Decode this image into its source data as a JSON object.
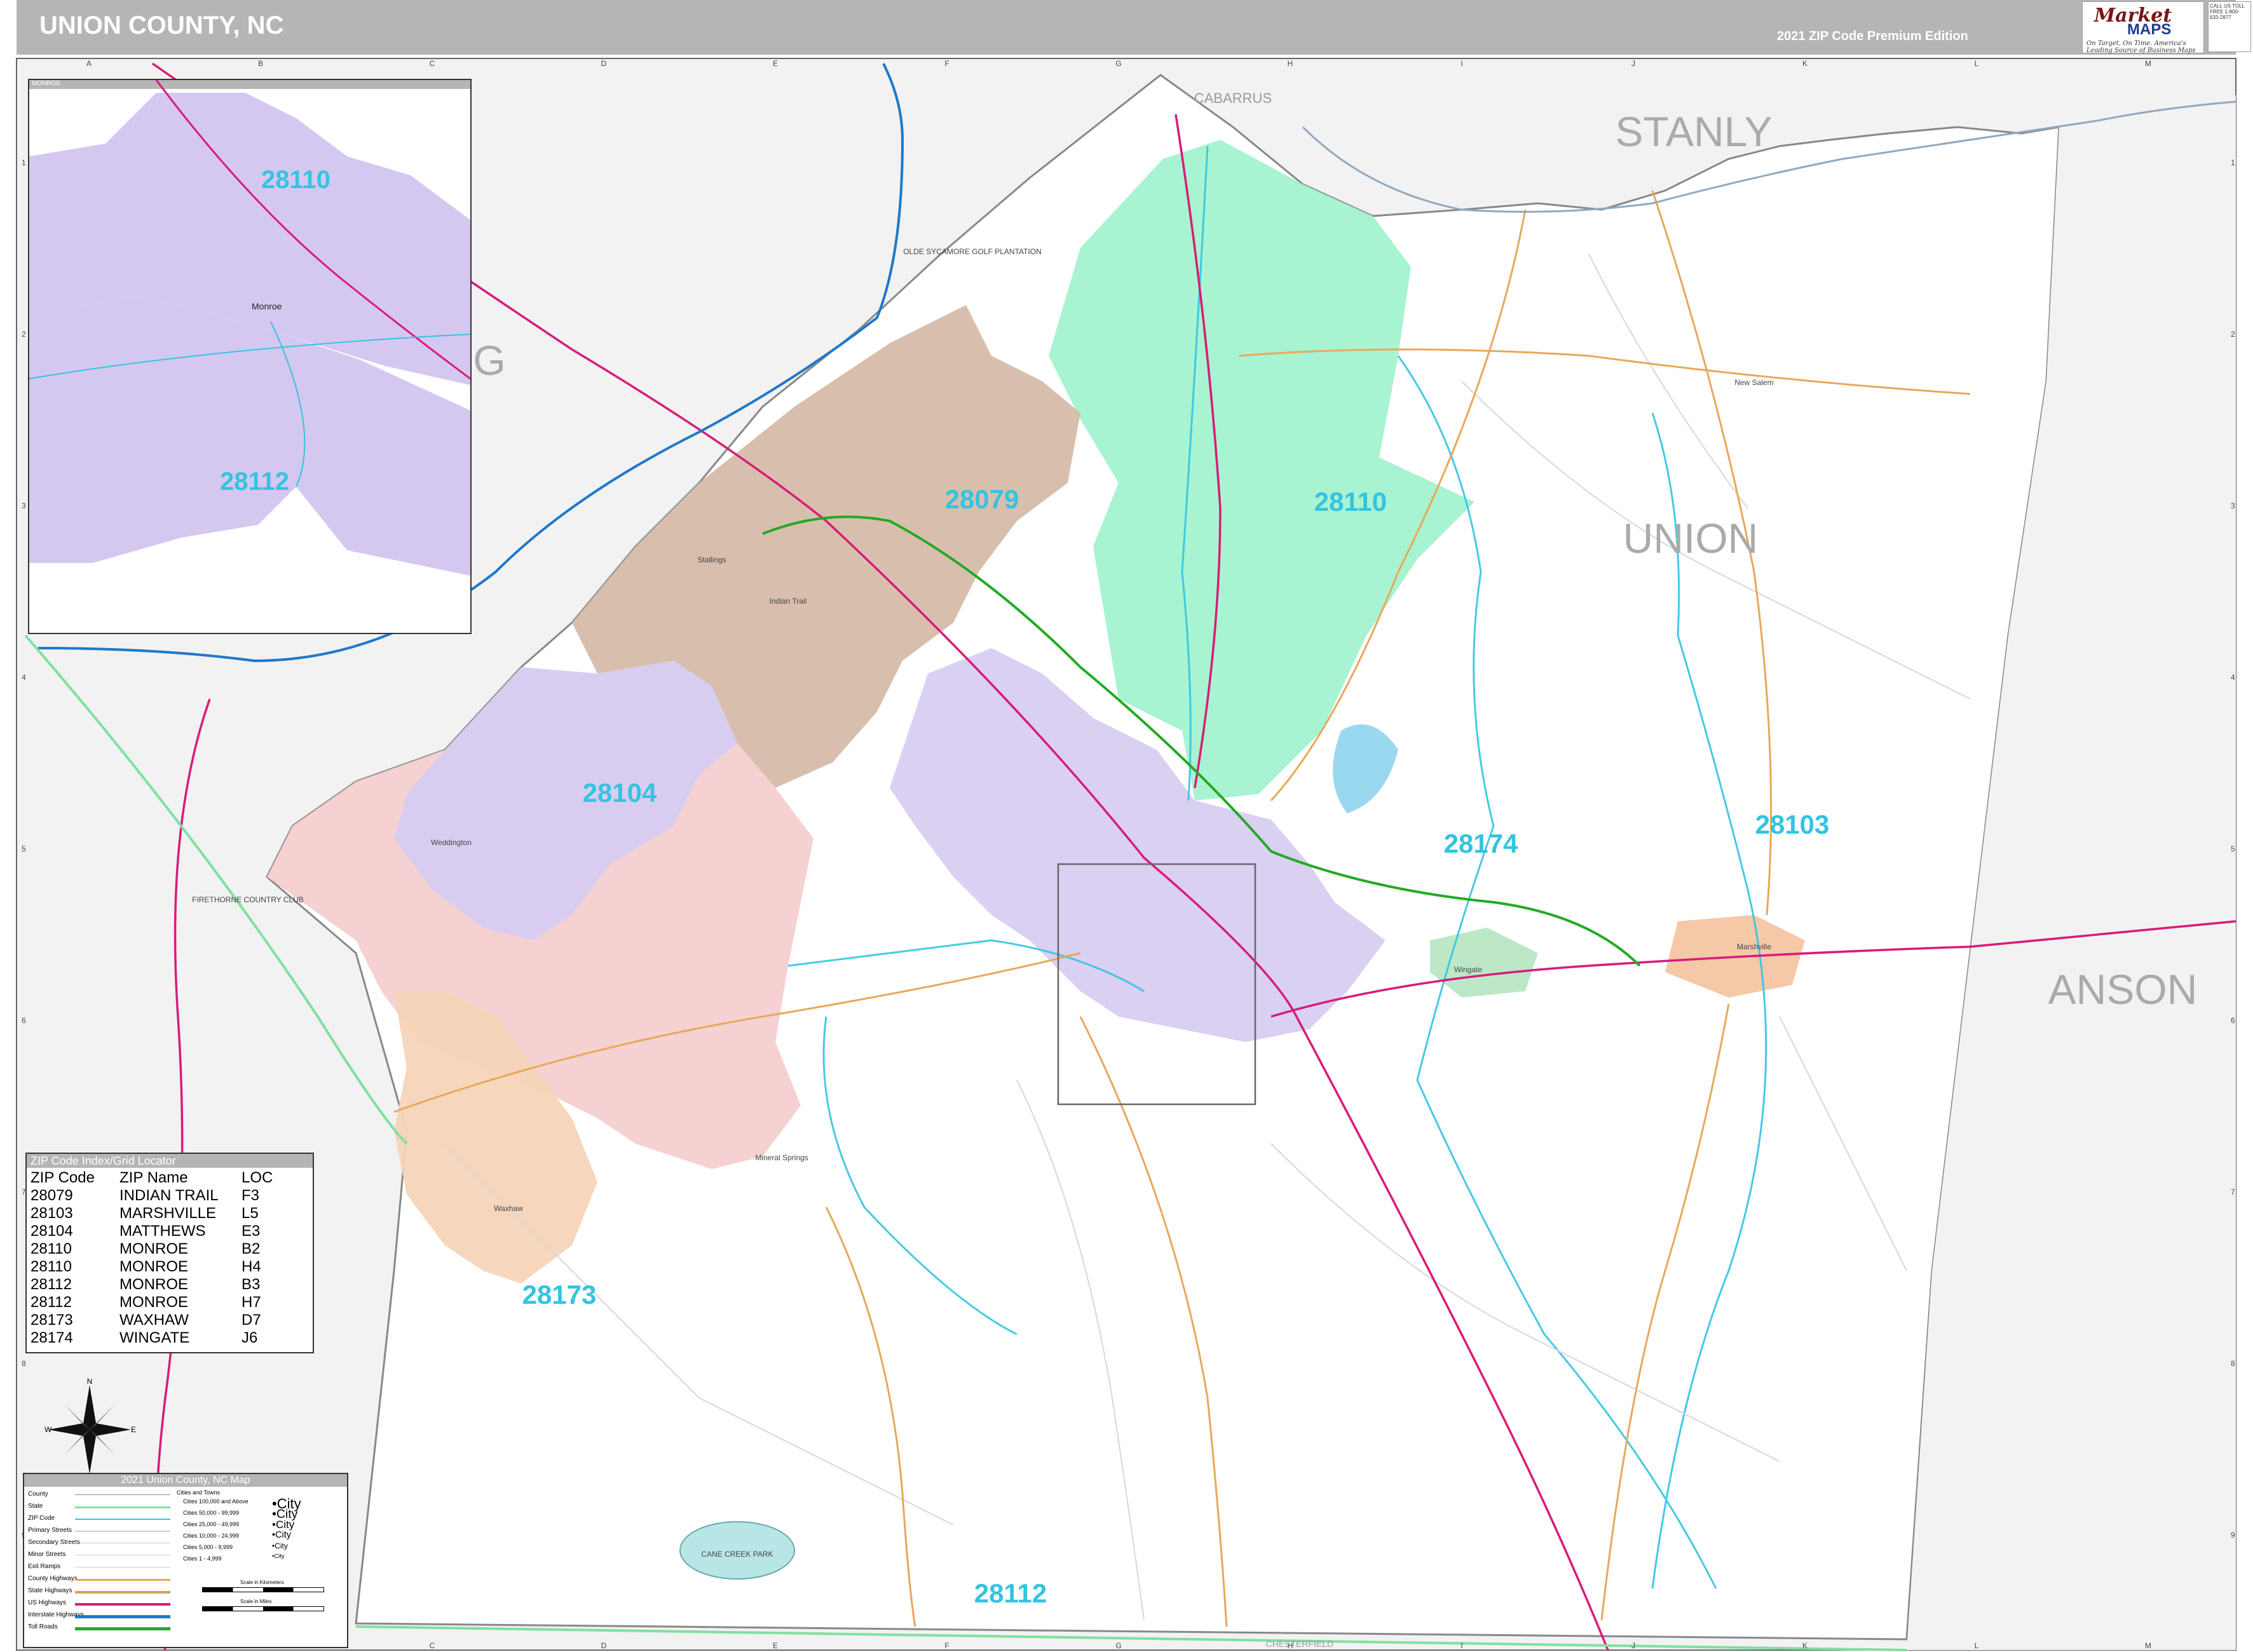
{
  "header": {
    "title": "UNION COUNTY, NC",
    "edition": "2021 ZIP Code Premium Edition",
    "logo_brand": "Market",
    "logo_maps": "MAPS",
    "logo_tagline": "On Target, On Time. America's Leading Source of Business Maps",
    "contact": "CALL US TOLL FREE 1-800-633-2877"
  },
  "grid": {
    "columns": [
      "A",
      "B",
      "C",
      "D",
      "E",
      "F",
      "G",
      "H",
      "I",
      "J",
      "K",
      "L",
      "M"
    ],
    "rows": [
      "1",
      "2",
      "3",
      "4",
      "5",
      "6",
      "7",
      "8",
      "9"
    ]
  },
  "counties": {
    "cabarrus": "CABARRUS",
    "stanly": "STANLY",
    "union": "UNION",
    "anson": "ANSON",
    "mecklenburg_partial": "G",
    "chesterfield": "CHESTERFIELD"
  },
  "zip_labels": {
    "z28079": "28079",
    "z28110": "28110",
    "z28174": "28174",
    "z28103": "28103",
    "z28104": "28104",
    "z28173": "28173",
    "z28112": "28112"
  },
  "places": {
    "monroe": "Monroe",
    "cane_creek_park": "CANE CREEK PARK",
    "olde_sycamore": "OLDE SYCAMORE GOLF PLANTATION",
    "firethorne": "FIRETHORNE COUNTRY CLUB",
    "stallings": "Stallings",
    "indian_trail": "Indian Trail",
    "wingate": "Wingate",
    "marshville": "Marshville",
    "waxhaw": "Waxhaw",
    "mineral_springs": "Mineral Springs",
    "weddington": "Weddington",
    "new_salem": "New Salem"
  },
  "inset": {
    "header": "MONROE",
    "zip_a": "28110",
    "zip_b": "28112",
    "city": "Monroe"
  },
  "zip_index": {
    "title": "ZIP Code Index/Grid Locator",
    "headers": [
      "ZIP Code",
      "ZIP Name",
      "LOC"
    ],
    "rows": [
      [
        "28079",
        "INDIAN TRAIL",
        "F3"
      ],
      [
        "28103",
        "MARSHVILLE",
        "L5"
      ],
      [
        "28104",
        "MATTHEWS",
        "E3"
      ],
      [
        "28110",
        "MONROE",
        "B2"
      ],
      [
        "28110",
        "MONROE",
        "H4"
      ],
      [
        "28112",
        "MONROE",
        "B3"
      ],
      [
        "28112",
        "MONROE",
        "H7"
      ],
      [
        "28173",
        "WAXHAW",
        "D7"
      ],
      [
        "28174",
        "WINGATE",
        "J6"
      ]
    ]
  },
  "legend": {
    "title": "2021 Union County, NC Map",
    "items": [
      "County",
      "State",
      "ZIP Code",
      "Primary Streets",
      "Secondary Streets",
      "Minor Streets",
      "Exit Ramps",
      "County Highways",
      "State Highways",
      "US Highways",
      "Interstate Highways",
      "Toll Roads"
    ],
    "cities_title": "Cities and Towns",
    "populations": [
      "Cities 100,000 and Above",
      "Cities 50,000 - 99,999",
      "Cities 25,000 - 49,999",
      "Cities 10,000 - 24,999",
      "Cities 5,000 - 9,999",
      "Cities 1 - 4,999"
    ],
    "city_samples": [
      "City",
      "City",
      "City",
      "City",
      "City",
      "City"
    ],
    "scale_km": "Scale in Kilometers",
    "scale_mi": "Scale in Miles",
    "colors": {
      "county": "#888888",
      "state": "#7fe0a0",
      "zip": "#33c4e0",
      "primary": "#cccccc",
      "county_hwy": "#e8a85a",
      "state_hwy": "#d4a060",
      "us_hwy": "#d81b7a",
      "interstate": "#1f78c8",
      "toll": "#22aa22"
    }
  },
  "compass": {
    "n": "N",
    "s": "S",
    "e": "E",
    "w": "W"
  },
  "colors": {
    "zip_label": "#33c4e0",
    "z28110": "#9ff2cc",
    "z28079": "#d4b8a4",
    "z28104": "#d4c8f0",
    "z28173_pink": "#f5cccc",
    "z28173_orange": "#f5d4b8",
    "outside": "#f2f2f2",
    "county_label": "#aaaaaa"
  }
}
